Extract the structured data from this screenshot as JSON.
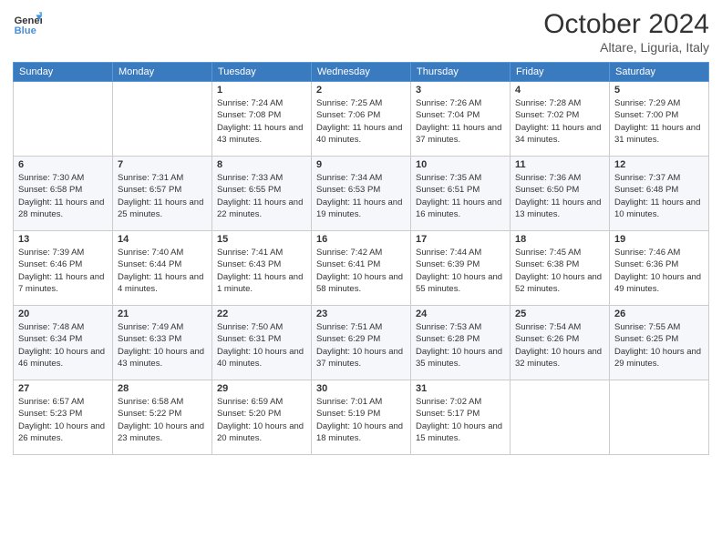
{
  "header": {
    "logo_line1": "General",
    "logo_line2": "Blue",
    "month": "October 2024",
    "location": "Altare, Liguria, Italy"
  },
  "weekdays": [
    "Sunday",
    "Monday",
    "Tuesday",
    "Wednesday",
    "Thursday",
    "Friday",
    "Saturday"
  ],
  "weeks": [
    [
      {
        "day": "",
        "sunrise": "",
        "sunset": "",
        "daylight": ""
      },
      {
        "day": "",
        "sunrise": "",
        "sunset": "",
        "daylight": ""
      },
      {
        "day": "1",
        "sunrise": "Sunrise: 7:24 AM",
        "sunset": "Sunset: 7:08 PM",
        "daylight": "Daylight: 11 hours and 43 minutes."
      },
      {
        "day": "2",
        "sunrise": "Sunrise: 7:25 AM",
        "sunset": "Sunset: 7:06 PM",
        "daylight": "Daylight: 11 hours and 40 minutes."
      },
      {
        "day": "3",
        "sunrise": "Sunrise: 7:26 AM",
        "sunset": "Sunset: 7:04 PM",
        "daylight": "Daylight: 11 hours and 37 minutes."
      },
      {
        "day": "4",
        "sunrise": "Sunrise: 7:28 AM",
        "sunset": "Sunset: 7:02 PM",
        "daylight": "Daylight: 11 hours and 34 minutes."
      },
      {
        "day": "5",
        "sunrise": "Sunrise: 7:29 AM",
        "sunset": "Sunset: 7:00 PM",
        "daylight": "Daylight: 11 hours and 31 minutes."
      }
    ],
    [
      {
        "day": "6",
        "sunrise": "Sunrise: 7:30 AM",
        "sunset": "Sunset: 6:58 PM",
        "daylight": "Daylight: 11 hours and 28 minutes."
      },
      {
        "day": "7",
        "sunrise": "Sunrise: 7:31 AM",
        "sunset": "Sunset: 6:57 PM",
        "daylight": "Daylight: 11 hours and 25 minutes."
      },
      {
        "day": "8",
        "sunrise": "Sunrise: 7:33 AM",
        "sunset": "Sunset: 6:55 PM",
        "daylight": "Daylight: 11 hours and 22 minutes."
      },
      {
        "day": "9",
        "sunrise": "Sunrise: 7:34 AM",
        "sunset": "Sunset: 6:53 PM",
        "daylight": "Daylight: 11 hours and 19 minutes."
      },
      {
        "day": "10",
        "sunrise": "Sunrise: 7:35 AM",
        "sunset": "Sunset: 6:51 PM",
        "daylight": "Daylight: 11 hours and 16 minutes."
      },
      {
        "day": "11",
        "sunrise": "Sunrise: 7:36 AM",
        "sunset": "Sunset: 6:50 PM",
        "daylight": "Daylight: 11 hours and 13 minutes."
      },
      {
        "day": "12",
        "sunrise": "Sunrise: 7:37 AM",
        "sunset": "Sunset: 6:48 PM",
        "daylight": "Daylight: 11 hours and 10 minutes."
      }
    ],
    [
      {
        "day": "13",
        "sunrise": "Sunrise: 7:39 AM",
        "sunset": "Sunset: 6:46 PM",
        "daylight": "Daylight: 11 hours and 7 minutes."
      },
      {
        "day": "14",
        "sunrise": "Sunrise: 7:40 AM",
        "sunset": "Sunset: 6:44 PM",
        "daylight": "Daylight: 11 hours and 4 minutes."
      },
      {
        "day": "15",
        "sunrise": "Sunrise: 7:41 AM",
        "sunset": "Sunset: 6:43 PM",
        "daylight": "Daylight: 11 hours and 1 minute."
      },
      {
        "day": "16",
        "sunrise": "Sunrise: 7:42 AM",
        "sunset": "Sunset: 6:41 PM",
        "daylight": "Daylight: 10 hours and 58 minutes."
      },
      {
        "day": "17",
        "sunrise": "Sunrise: 7:44 AM",
        "sunset": "Sunset: 6:39 PM",
        "daylight": "Daylight: 10 hours and 55 minutes."
      },
      {
        "day": "18",
        "sunrise": "Sunrise: 7:45 AM",
        "sunset": "Sunset: 6:38 PM",
        "daylight": "Daylight: 10 hours and 52 minutes."
      },
      {
        "day": "19",
        "sunrise": "Sunrise: 7:46 AM",
        "sunset": "Sunset: 6:36 PM",
        "daylight": "Daylight: 10 hours and 49 minutes."
      }
    ],
    [
      {
        "day": "20",
        "sunrise": "Sunrise: 7:48 AM",
        "sunset": "Sunset: 6:34 PM",
        "daylight": "Daylight: 10 hours and 46 minutes."
      },
      {
        "day": "21",
        "sunrise": "Sunrise: 7:49 AM",
        "sunset": "Sunset: 6:33 PM",
        "daylight": "Daylight: 10 hours and 43 minutes."
      },
      {
        "day": "22",
        "sunrise": "Sunrise: 7:50 AM",
        "sunset": "Sunset: 6:31 PM",
        "daylight": "Daylight: 10 hours and 40 minutes."
      },
      {
        "day": "23",
        "sunrise": "Sunrise: 7:51 AM",
        "sunset": "Sunset: 6:29 PM",
        "daylight": "Daylight: 10 hours and 37 minutes."
      },
      {
        "day": "24",
        "sunrise": "Sunrise: 7:53 AM",
        "sunset": "Sunset: 6:28 PM",
        "daylight": "Daylight: 10 hours and 35 minutes."
      },
      {
        "day": "25",
        "sunrise": "Sunrise: 7:54 AM",
        "sunset": "Sunset: 6:26 PM",
        "daylight": "Daylight: 10 hours and 32 minutes."
      },
      {
        "day": "26",
        "sunrise": "Sunrise: 7:55 AM",
        "sunset": "Sunset: 6:25 PM",
        "daylight": "Daylight: 10 hours and 29 minutes."
      }
    ],
    [
      {
        "day": "27",
        "sunrise": "Sunrise: 6:57 AM",
        "sunset": "Sunset: 5:23 PM",
        "daylight": "Daylight: 10 hours and 26 minutes."
      },
      {
        "day": "28",
        "sunrise": "Sunrise: 6:58 AM",
        "sunset": "Sunset: 5:22 PM",
        "daylight": "Daylight: 10 hours and 23 minutes."
      },
      {
        "day": "29",
        "sunrise": "Sunrise: 6:59 AM",
        "sunset": "Sunset: 5:20 PM",
        "daylight": "Daylight: 10 hours and 20 minutes."
      },
      {
        "day": "30",
        "sunrise": "Sunrise: 7:01 AM",
        "sunset": "Sunset: 5:19 PM",
        "daylight": "Daylight: 10 hours and 18 minutes."
      },
      {
        "day": "31",
        "sunrise": "Sunrise: 7:02 AM",
        "sunset": "Sunset: 5:17 PM",
        "daylight": "Daylight: 10 hours and 15 minutes."
      },
      {
        "day": "",
        "sunrise": "",
        "sunset": "",
        "daylight": ""
      },
      {
        "day": "",
        "sunrise": "",
        "sunset": "",
        "daylight": ""
      }
    ]
  ]
}
